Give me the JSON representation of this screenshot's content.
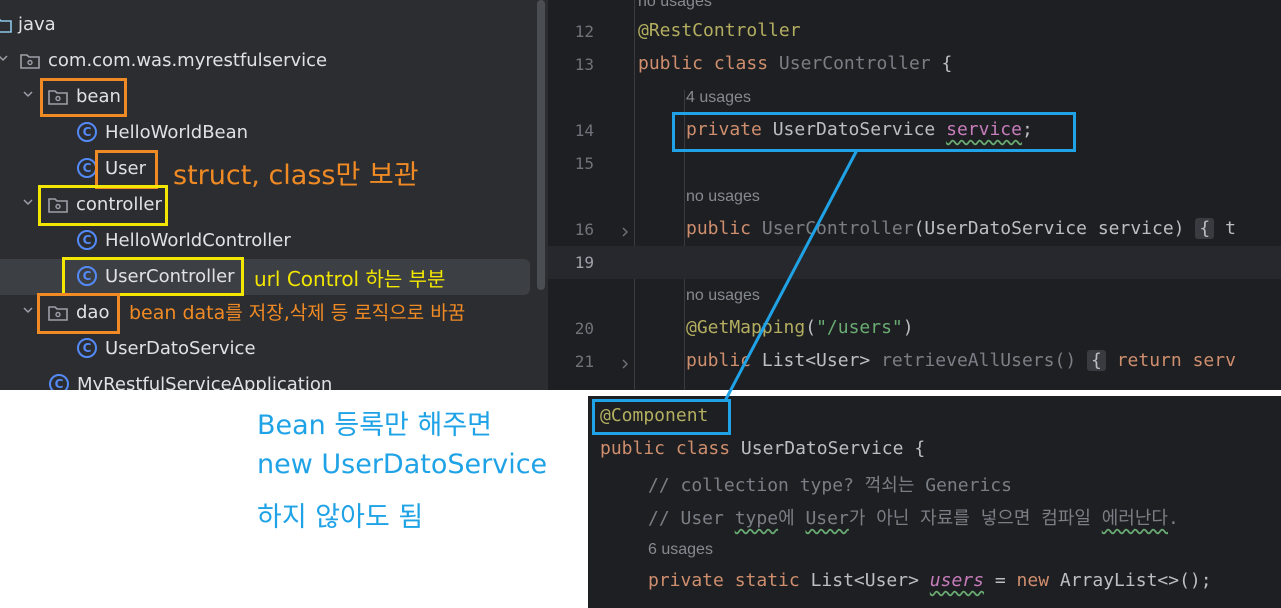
{
  "tree": {
    "items": [
      {
        "label": "java",
        "kind": "folder"
      },
      {
        "label": "com.com.was.myrestfulservice",
        "kind": "package"
      },
      {
        "label": "bean",
        "kind": "package"
      },
      {
        "label": "HelloWorldBean",
        "kind": "class"
      },
      {
        "label": "User",
        "kind": "class"
      },
      {
        "label": "controller",
        "kind": "package"
      },
      {
        "label": "HelloWorldController",
        "kind": "class"
      },
      {
        "label": "UserController",
        "kind": "class"
      },
      {
        "label": "dao",
        "kind": "package"
      },
      {
        "label": "UserDatoService",
        "kind": "class"
      },
      {
        "label": "MyRestfulServiceApplication",
        "kind": "class"
      }
    ],
    "selected_item": "UserController"
  },
  "editor_top": {
    "lines": [
      {
        "num": "",
        "hint": "no usages"
      },
      {
        "num": "12",
        "code_annotation": "@RestController"
      },
      {
        "num": "13",
        "kw1": "public",
        "kw2": "class",
        "name": "UserController",
        "brace": "{"
      },
      {
        "num": "",
        "hint": "4 usages"
      },
      {
        "num": "14",
        "kw": "private",
        "type": "UserDatoService",
        "field": "service",
        "semi": ";"
      },
      {
        "num": "15"
      },
      {
        "num": "",
        "hint": "no usages"
      },
      {
        "num": "16",
        "kw": "public",
        "name": "UserController",
        "params": "(UserDatoService service)",
        "fold": "{",
        "rest": "t"
      },
      {
        "num": "19"
      },
      {
        "num": "",
        "hint": "no usages"
      },
      {
        "num": "20",
        "annotation": "@GetMapping",
        "open": "(",
        "string": "\"/users\"",
        "close": ")"
      },
      {
        "num": "21",
        "kw": "public",
        "type": "List<User>",
        "method": "retrieveAllUsers()",
        "fold": "{",
        "ret": "return",
        "rest": "serv"
      }
    ],
    "current_line": "19"
  },
  "editor_bottom": {
    "annotation": "@Component",
    "decl_kw1": "public",
    "decl_kw2": "class",
    "decl_name": "UserDatoService",
    "decl_brace": "{",
    "comment1": "// collection type? 꺽쇠는 Generics",
    "comment2_a": "// User ",
    "comment2_b": "type",
    "comment2_c": "에 ",
    "comment2_d": "User",
    "comment2_e": "가 아닌 자료를 넣으면 컴파일 ",
    "comment2_f": "에러난다",
    "comment2_g": ".",
    "hint": "6 usages",
    "field_kw1": "private",
    "field_kw2": "static",
    "field_type": "List<User>",
    "field_name": "users",
    "field_eq": "=",
    "field_new": "new",
    "field_init": "ArrayList<>();"
  },
  "annotations": {
    "bean_note": "struct, class만 보관",
    "controller_note": "url Control 하는 부분",
    "dao_note": "bean data를 저장,삭제 등 로직으로 바꿈",
    "component_note_line1": "Bean 등록만 해주면",
    "component_note_line2": "new UserDatoService",
    "component_note_line3": "하지 않아도 됨"
  },
  "colors": {
    "orange_box": "#f08a24",
    "yellow_box": "#f3e600",
    "blue_box": "#1fa3e6",
    "editor_bg": "#1e1f22",
    "tree_bg": "#2b2d30"
  }
}
